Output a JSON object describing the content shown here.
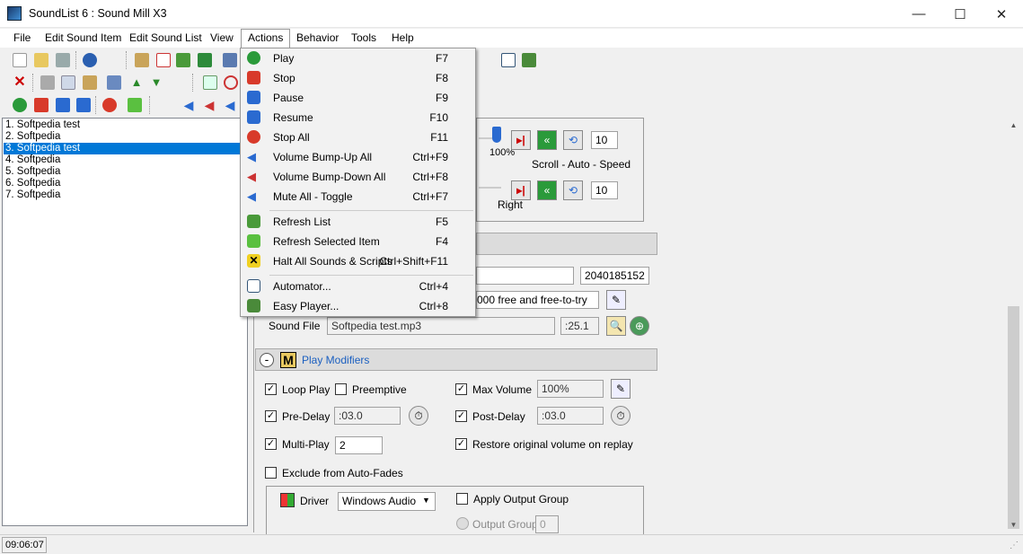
{
  "window": {
    "title": "SoundList 6 : Sound Mill X3",
    "minimize": "—",
    "maximize": "☐",
    "close": "✕"
  },
  "menubar": [
    "File",
    "Edit Sound Item",
    "Edit Sound List",
    "View",
    "Actions",
    "Behavior",
    "Tools",
    "Help"
  ],
  "sound_list": [
    "1. Softpedia test",
    "2. Softpedia",
    "3. Softpedia test",
    "4. Softpedia",
    "5. Softpedia",
    "6. Softpedia",
    "7. Softpedia"
  ],
  "selected_index": 2,
  "actions_menu": {
    "group1": [
      {
        "label": "Play",
        "key": "F7"
      },
      {
        "label": "Stop",
        "key": "F8"
      },
      {
        "label": "Pause",
        "key": "F9"
      },
      {
        "label": "Resume",
        "key": "F10"
      },
      {
        "label": "Stop All",
        "key": "F11"
      },
      {
        "label": "Volume Bump-Up All",
        "key": "Ctrl+F9"
      },
      {
        "label": "Volume Bump-Down All",
        "key": "Ctrl+F8"
      },
      {
        "label": "Mute All - Toggle",
        "key": "Ctrl+F7"
      }
    ],
    "group2": [
      {
        "label": "Refresh List",
        "key": "F5"
      },
      {
        "label": "Refresh Selected Item",
        "key": "F4"
      },
      {
        "label": "Halt All Sounds & Scripts",
        "key": "Ctrl+Shift+F11"
      }
    ],
    "group3": [
      {
        "label": "Automator...",
        "key": "Ctrl+4"
      },
      {
        "label": "Easy Player...",
        "key": "Ctrl+8"
      }
    ]
  },
  "controls": {
    "volume_pct": "100%",
    "left_speed": "10",
    "right_speed": "10",
    "scroll_label": "Scroll - Auto - Speed",
    "right_label": "Right",
    "id_value": "2040185152",
    "license_text": "000 free and free-to-try",
    "sound_file_label": "Sound File",
    "sound_file_value": "Softpedia test.mp3",
    "duration": ":25.1"
  },
  "play_modifiers": {
    "toggle": "-",
    "icon_letter": "M",
    "title": "Play Modifiers",
    "loop_play": "Loop Play",
    "preemptive": "Preemptive",
    "max_volume": "Max Volume",
    "max_volume_value": "100%",
    "pre_delay": "Pre-Delay",
    "pre_delay_value": ":03.0",
    "post_delay": "Post-Delay",
    "post_delay_value": ":03.0",
    "multi_play": "Multi-Play",
    "multi_play_value": "2",
    "restore_volume": "Restore original volume on replay",
    "exclude_auto_fades": "Exclude from Auto-Fades",
    "driver_label": "Driver",
    "driver_value": "Windows Audio",
    "apply_output_group": "Apply Output Group",
    "output_group": "Output Group",
    "output_group_value": "0"
  },
  "status": {
    "time": "09:06:07"
  }
}
